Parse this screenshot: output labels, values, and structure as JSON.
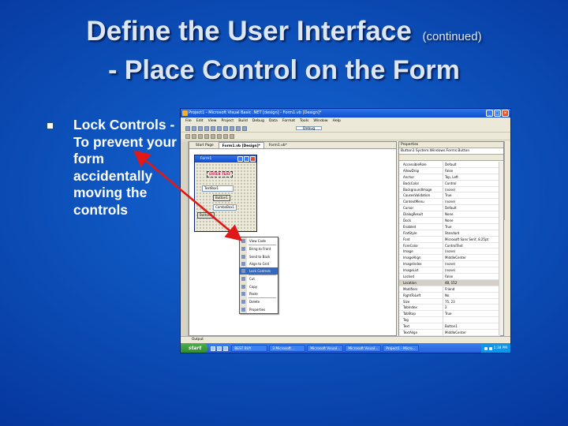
{
  "slide": {
    "title_main": "Define the User Interface",
    "title_suffix": "(continued)",
    "title_line2": "- Place Control on the Form",
    "bullet": "Lock Controls -To prevent your form accidentally moving the controls"
  },
  "colors": {
    "background": "#0b4cb4",
    "title_text": "#dde6f4",
    "arrow": "#e01818"
  },
  "screenshot": {
    "window_title": "Project1 - Microsoft Visual Basic .NET [design] - Form1.vb [Design]*",
    "menu": [
      "File",
      "Edit",
      "View",
      "Project",
      "Build",
      "Debug",
      "Data",
      "Format",
      "Tools",
      "Window",
      "Help"
    ],
    "debug_combo": "Debug",
    "tabs": [
      "Start Page",
      "Form1.vb [Design]*",
      "Form1.vb*"
    ],
    "form": {
      "title": "Form1",
      "label_text": "ENTER TEXT",
      "textbox": "TextBox1",
      "button1": "Button1",
      "button2": "Button2",
      "combo": "ComboBox1"
    },
    "context_menu": [
      {
        "label": "View Code",
        "highlight": false
      },
      {
        "label": "Bring to Front",
        "highlight": false
      },
      {
        "label": "Send to Back",
        "highlight": false
      },
      {
        "label": "Align to Grid",
        "highlight": false
      },
      {
        "label": "Lock Controls",
        "highlight": true
      },
      {
        "label": "Cut",
        "highlight": false
      },
      {
        "label": "Copy",
        "highlight": false
      },
      {
        "label": "Paste",
        "highlight": false
      },
      {
        "label": "Delete",
        "highlight": false
      },
      {
        "label": "Properties",
        "highlight": false
      }
    ],
    "properties_title": "Properties",
    "properties_object": "Button1  System.Windows.Forms.Button",
    "properties": [
      {
        "name": "AccessibleRole",
        "value": "Default"
      },
      {
        "name": "AllowDrop",
        "value": "False"
      },
      {
        "name": "Anchor",
        "value": "Top, Left"
      },
      {
        "name": "BackColor",
        "value": "Control"
      },
      {
        "name": "BackgroundImage",
        "value": "(none)"
      },
      {
        "name": "CausesValidation",
        "value": "True"
      },
      {
        "name": "ContextMenu",
        "value": "(none)"
      },
      {
        "name": "Cursor",
        "value": "Default"
      },
      {
        "name": "DialogResult",
        "value": "None"
      },
      {
        "name": "Dock",
        "value": "None"
      },
      {
        "name": "Enabled",
        "value": "True"
      },
      {
        "name": "FlatStyle",
        "value": "Standard"
      },
      {
        "name": "Font",
        "value": "Microsoft Sans Serif, 8.25pt"
      },
      {
        "name": "ForeColor",
        "value": "ControlText"
      },
      {
        "name": "Image",
        "value": "(none)"
      },
      {
        "name": "ImageAlign",
        "value": "MiddleCenter"
      },
      {
        "name": "ImageIndex",
        "value": "(none)"
      },
      {
        "name": "ImageList",
        "value": "(none)"
      },
      {
        "name": "Locked",
        "value": "False"
      },
      {
        "name": "Location",
        "value": "48, 152"
      },
      {
        "name": "Modifiers",
        "value": "Friend"
      },
      {
        "name": "RightToLeft",
        "value": "No"
      },
      {
        "name": "Size",
        "value": "75, 23"
      },
      {
        "name": "TabIndex",
        "value": "2"
      },
      {
        "name": "TabStop",
        "value": "True"
      },
      {
        "name": "Tag",
        "value": ""
      },
      {
        "name": "Text",
        "value": "Button1"
      },
      {
        "name": "TextAlign",
        "value": "MiddleCenter"
      },
      {
        "name": "Visible",
        "value": "True"
      }
    ],
    "output_label": "Output",
    "status": "Ready",
    "start_label": "start",
    "taskbar_items": [
      "BEST BUY",
      "3 Microsoft...",
      "Microsoft Visual...",
      "Microsoft Visual...",
      "Project1 - Micro..."
    ],
    "clock": "1:38 PM"
  }
}
